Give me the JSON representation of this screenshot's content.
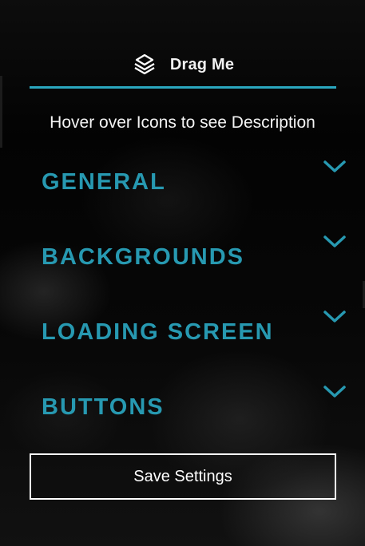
{
  "header": {
    "title": "Drag Me",
    "icon": "stacked-layers-icon"
  },
  "hint": {
    "text": "Hover over Icons to see Description"
  },
  "sections": [
    {
      "label": "GENERAL",
      "icon": "chevron-down-icon"
    },
    {
      "label": "BACKGROUNDS",
      "icon": "chevron-down-icon"
    },
    {
      "label": "LOADING SCREEN",
      "icon": "chevron-down-icon"
    },
    {
      "label": "BUTTONS",
      "icon": "chevron-down-icon"
    }
  ],
  "actions": {
    "save_label": "Save Settings"
  },
  "colors": {
    "accent": "#2799b1",
    "divider": "#2aa7bf",
    "text": "#f4f4f4",
    "background": "#050505"
  }
}
